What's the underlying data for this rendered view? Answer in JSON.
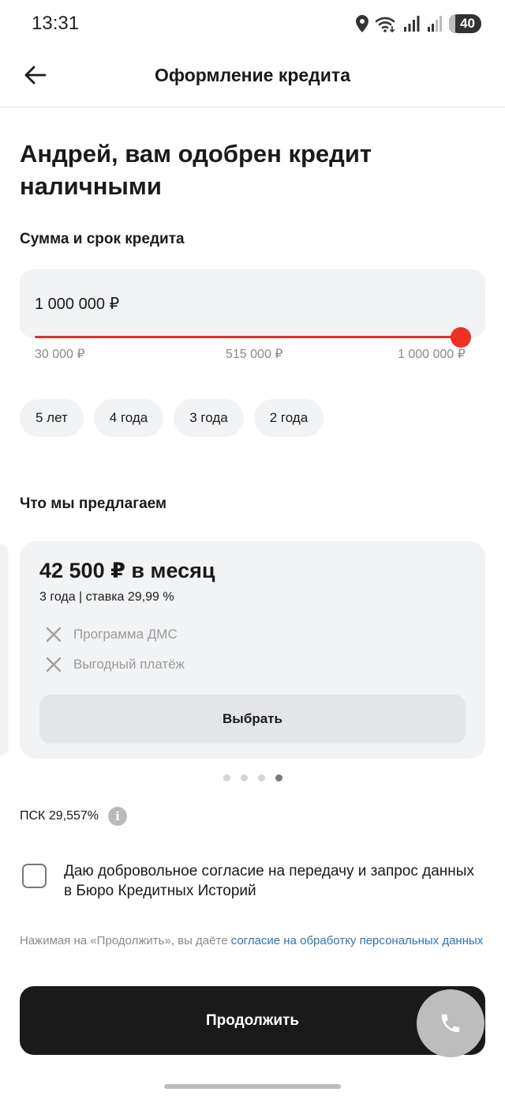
{
  "status_bar": {
    "time": "13:31",
    "battery": "40"
  },
  "header": {
    "title": "Оформление кредита"
  },
  "headline": "Андрей, вам одобрен кредит наличными",
  "amount_section": {
    "label": "Сумма и срок кредита",
    "value": "1 000 000 ₽",
    "slider_level": 1.0,
    "ticks": [
      "30 000 ₽",
      "515 000 ₽",
      "1 000 000 ₽"
    ]
  },
  "terms": [
    "5 лет",
    "4 года",
    "3 года",
    "2 года"
  ],
  "offers_section": {
    "label": "Что мы предлагаем",
    "offer": {
      "price": "42 500 ₽ в месяц",
      "terms": "3 года | ставка 29,99 %",
      "features": [
        "Программа ДМС",
        "Выгодный платёж"
      ],
      "select_label": "Выбрать"
    },
    "pagination": {
      "total": 4,
      "active": 4
    }
  },
  "psk": "ПСК 29,557%",
  "consent": {
    "text": "Даю добровольное согласие на передачу и запрос данных в Бюро Кредитных Историй"
  },
  "legal": {
    "prefix": "Нажимая на «Продолжить», вы даёте",
    "link": "согласие на обработку персональных данных"
  },
  "continue_label": "Продолжить",
  "colors": {
    "accent": "#ef3124",
    "primary_button": "#1a1a1a",
    "link": "#2e74b8"
  }
}
